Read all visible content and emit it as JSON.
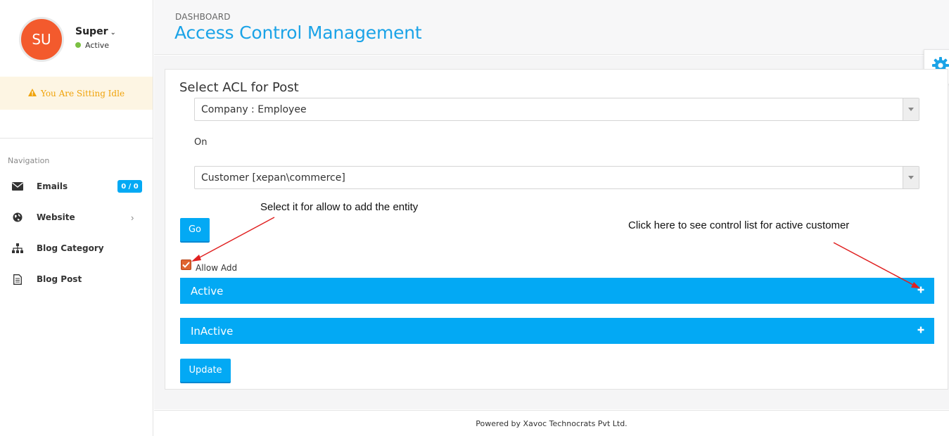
{
  "user": {
    "initials": "SU",
    "name": "Super",
    "status": "Active"
  },
  "idle_notice": "You Are Sitting Idle",
  "sidebar": {
    "nav_title": "Navigation",
    "items": [
      {
        "label": "Emails",
        "icon": "envelope-icon",
        "badge": "0 / 0"
      },
      {
        "label": "Website",
        "icon": "globe-icon"
      },
      {
        "label": "Blog Category",
        "icon": "sitemap-icon"
      },
      {
        "label": "Blog Post",
        "icon": "document-icon"
      }
    ]
  },
  "header": {
    "breadcrumb": "DASHBOARD",
    "title": "Access Control Management"
  },
  "form": {
    "label": "Select ACL for Post",
    "role_select": "Company : Employee",
    "on_label": "On",
    "entity_select": "Customer [xepan\\commerce]",
    "go_label": "Go",
    "allow_add_label": "Allow Add",
    "allow_add_checked": true,
    "sections": [
      {
        "title": "Active"
      },
      {
        "title": "InActive"
      }
    ],
    "update_label": "Update"
  },
  "annotations": {
    "checkbox_hint": "Select it for allow to add the entity",
    "expand_hint": "Click here to see control list for active customer"
  },
  "footer": "Powered by Xavoc Technocrats Pvt Ltd.",
  "colors": {
    "accent": "#03a9f4",
    "title": "#1ba3e7",
    "avatar": "#f35a2d",
    "idle_bg": "#fdf5e3",
    "idle_text": "#f0a30a",
    "status_dot": "#7bc043",
    "annotation_arrow": "#e02020"
  }
}
